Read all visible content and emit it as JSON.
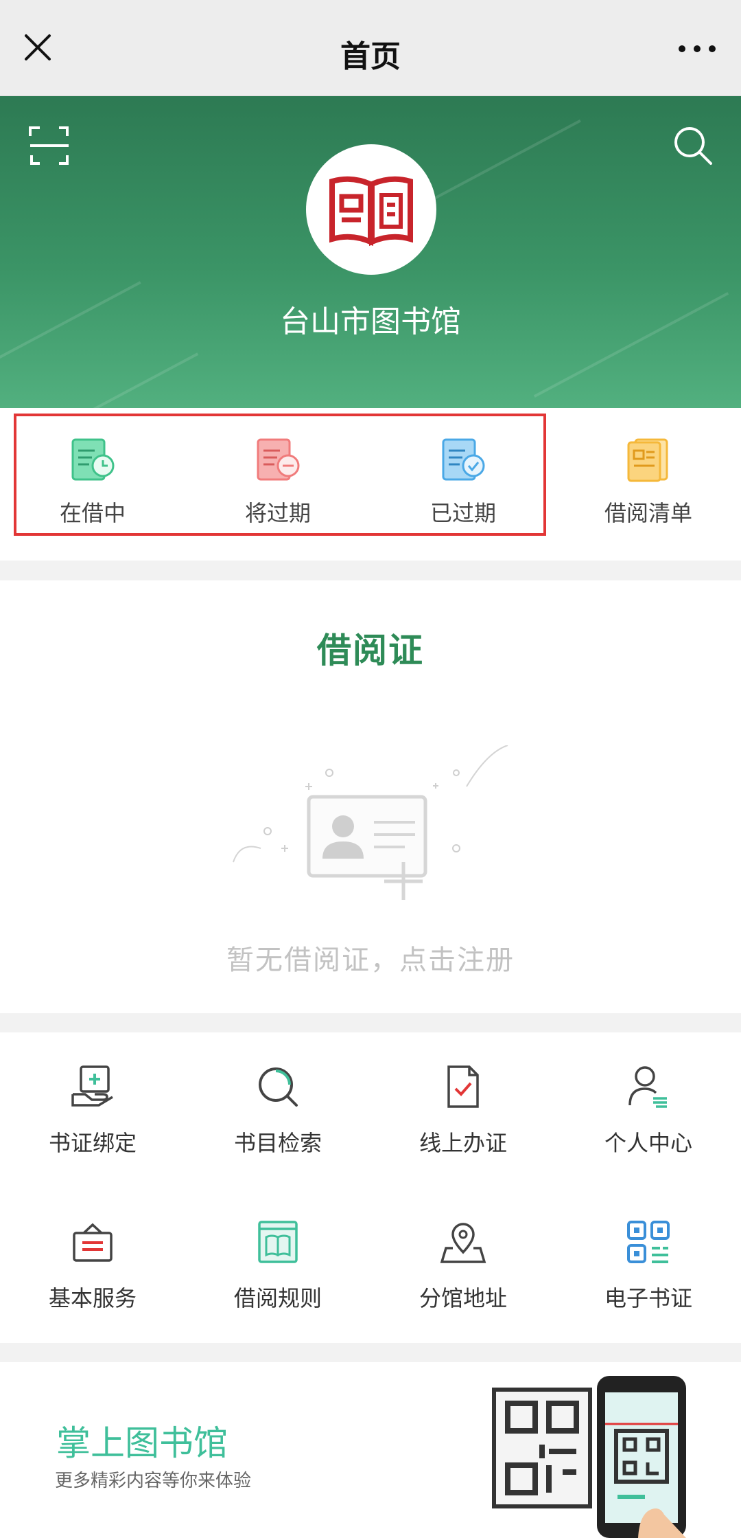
{
  "topbar": {
    "title": "首页"
  },
  "hero": {
    "library_name": "台山市图书馆"
  },
  "quick_actions": [
    {
      "label": "在借中",
      "icon": "book-clock-icon",
      "color": "#3fc28a"
    },
    {
      "label": "将过期",
      "icon": "book-minus-icon",
      "color": "#f07b7b"
    },
    {
      "label": "已过期",
      "icon": "book-check-icon",
      "color": "#4aa8e6"
    },
    {
      "label": "借阅清单",
      "icon": "book-list-icon",
      "color": "#f5b83a"
    }
  ],
  "library_card": {
    "title": "借阅证",
    "empty_text": "暂无借阅证，点击注册"
  },
  "services": [
    {
      "label": "书证绑定",
      "icon": "card-bind-icon"
    },
    {
      "label": "书目检索",
      "icon": "catalog-search-icon"
    },
    {
      "label": "线上办证",
      "icon": "online-apply-icon"
    },
    {
      "label": "个人中心",
      "icon": "user-center-icon"
    },
    {
      "label": "基本服务",
      "icon": "basic-service-icon"
    },
    {
      "label": "借阅规则",
      "icon": "borrow-rules-icon"
    },
    {
      "label": "分馆地址",
      "icon": "branch-location-icon"
    },
    {
      "label": "电子书证",
      "icon": "qr-card-icon"
    }
  ],
  "banner": {
    "title": "掌上图书馆",
    "subtitle": "更多精彩内容等你来体验"
  },
  "colors": {
    "brand_green": "#2e8b57",
    "teal": "#3fbf9a",
    "highlight_red": "#e23636"
  }
}
